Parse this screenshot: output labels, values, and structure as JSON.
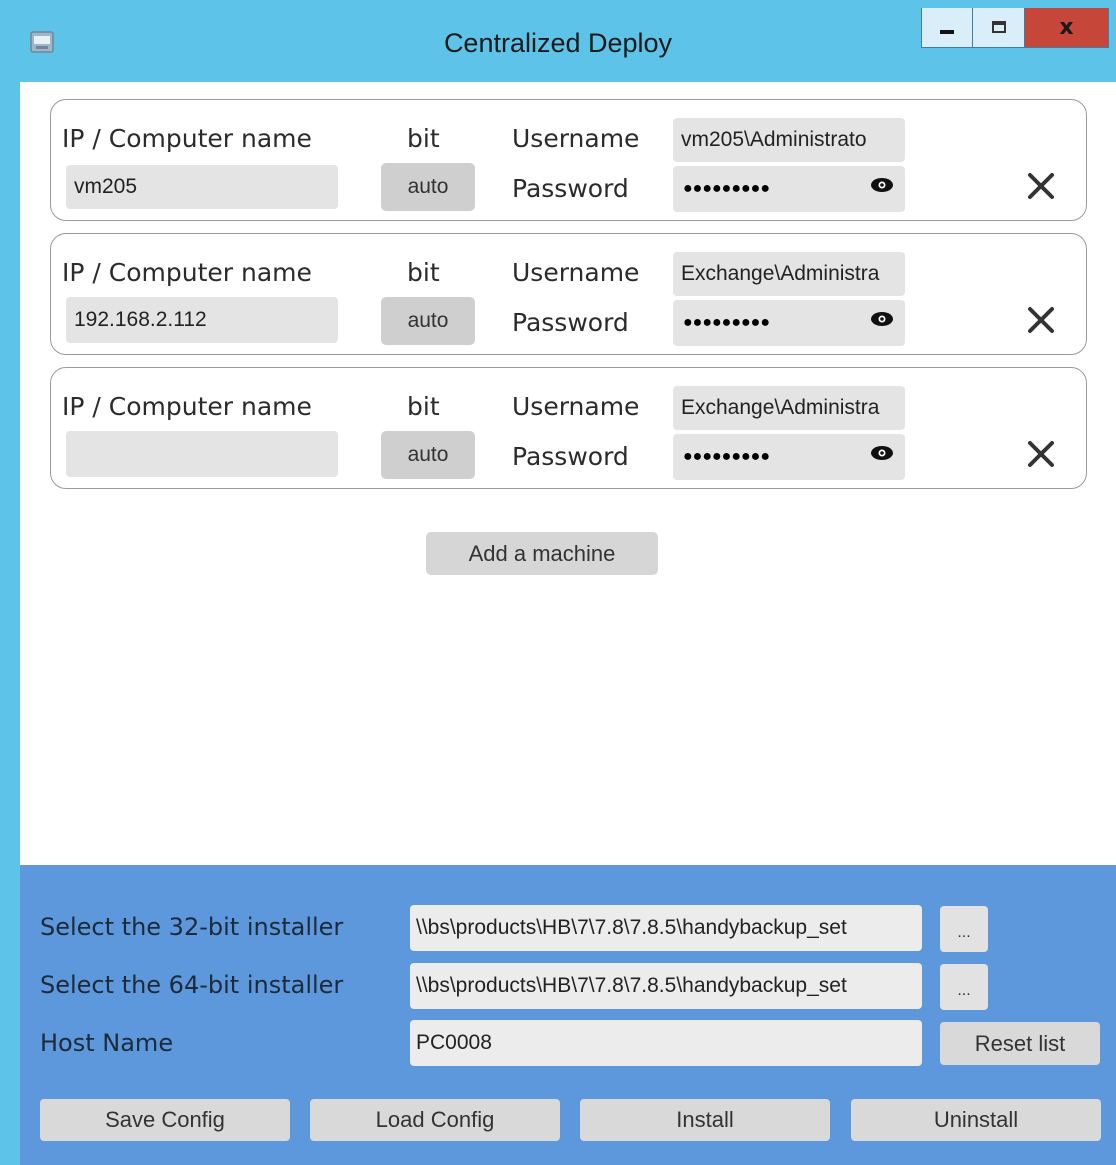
{
  "window": {
    "title": "Centralized Deploy",
    "icon": "app-window-icon",
    "controls": {
      "minimize": "minimize-icon",
      "maximize": "maximize-icon",
      "close": "close-icon"
    },
    "close_glyph": "x"
  },
  "machines": [
    {
      "ip_label": "IP / Computer name",
      "ip_value": "vm205",
      "bit_label": "bit",
      "bit_value": "auto",
      "username_label": "Username",
      "username_value": "vm205\\Administrato",
      "password_label": "Password",
      "password_value": "●●●●●●●●●"
    },
    {
      "ip_label": "IP / Computer name",
      "ip_value": "192.168.2.112",
      "bit_label": "bit",
      "bit_value": "auto",
      "username_label": "Username",
      "username_value": "Exchange\\Administra",
      "password_label": "Password",
      "password_value": "●●●●●●●●●"
    },
    {
      "ip_label": "IP / Computer name",
      "ip_value": "",
      "bit_label": "bit",
      "bit_value": "auto",
      "username_label": "Username",
      "username_value": "Exchange\\Administra",
      "password_label": "Password",
      "password_value": "●●●●●●●●●"
    }
  ],
  "add_machine_label": "Add a machine",
  "installer32": {
    "label": "Select the 32-bit installer",
    "path": "\\\\bs\\products\\HB\\7\\7.8\\7.8.5\\handybackup_set",
    "browse_label": "..."
  },
  "installer64": {
    "label": "Select the 64-bit installer",
    "path": "\\\\bs\\products\\HB\\7\\7.8\\7.8.5\\handybackup_set",
    "browse_label": "..."
  },
  "host": {
    "label": "Host Name",
    "value": "PC0008",
    "reset_label": "Reset list"
  },
  "actions": {
    "save": "Save Config",
    "load": "Load Config",
    "install": "Install",
    "uninstall": "Uninstall"
  },
  "colors": {
    "titlebar": "#5ec3e8",
    "bottom_panel": "#5d98dc",
    "close_button": "#c7463a"
  }
}
